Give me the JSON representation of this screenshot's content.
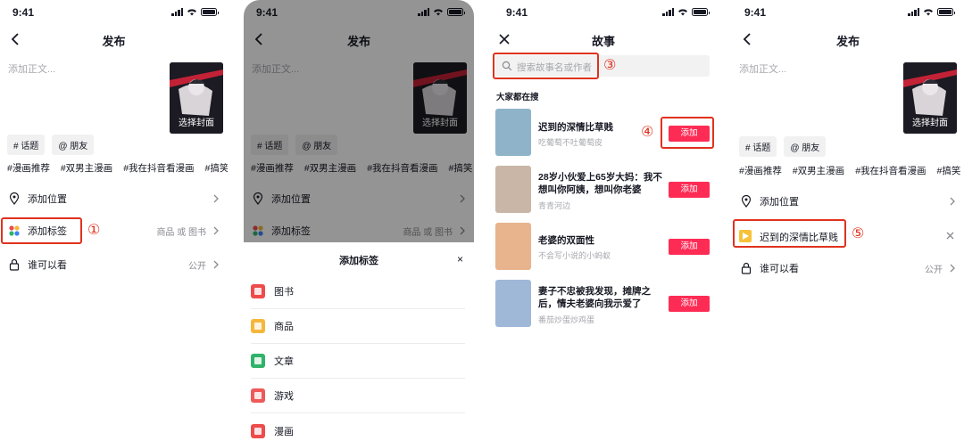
{
  "status": {
    "time": "9:41"
  },
  "screen1": {
    "title": "发布",
    "body_placeholder": "添加正文...",
    "cover_label": "选择封面",
    "chips": [
      "# 话题",
      "@ 朋友"
    ],
    "topics": [
      "#漫画推荐",
      "#双男主漫画",
      "#我在抖音看漫画",
      "#搞笑"
    ],
    "rows": {
      "location": "添加位置",
      "tag": "添加标签",
      "tag_value": "商品  或 图书",
      "visibility": "谁可以看",
      "visibility_value": "公开"
    },
    "marker": "①"
  },
  "screen2": {
    "title": "发布",
    "body_placeholder": "添加正文...",
    "cover_label": "选择封面",
    "chips": [
      "# 话题",
      "@ 朋友"
    ],
    "topics": [
      "#漫画推荐",
      "#双男主漫画",
      "#我在抖音看漫画",
      "#搞笑"
    ],
    "rows": {
      "location": "添加位置",
      "tag": "添加标签",
      "tag_value": "商品  或 图书"
    },
    "sheet": {
      "title": "添加标签",
      "close": "×",
      "items": [
        {
          "label": "图书",
          "color": "#ee4b4b"
        },
        {
          "label": "商品",
          "color": "#f5b73b"
        },
        {
          "label": "文章",
          "color": "#2fb36a"
        },
        {
          "label": "游戏",
          "color": "#ee5a5a"
        },
        {
          "label": "漫画",
          "color": "#ee4b4b"
        }
      ]
    }
  },
  "screen3": {
    "title": "故事",
    "search_placeholder": "搜索故事名或作者",
    "marker_search": "③",
    "marker_add": "④",
    "popular_label": "大家都在搜",
    "add_label": "添加",
    "stories": [
      {
        "title": "迟到的深情比草贱",
        "author": "吃葡萄不吐葡萄皮",
        "thumb": "#8fb3c9"
      },
      {
        "title": "28岁小伙爱上65岁大妈：我不想叫你阿姨，想叫你老婆",
        "author": "青青河边",
        "thumb": "#c9b6a6"
      },
      {
        "title": "老婆的双面性",
        "author": "不会写小说的小蚂蚁",
        "thumb": "#e7b48d"
      },
      {
        "title": "妻子不忠被我发现，摊牌之后，情夫老婆向我示爱了",
        "author": "番茄炒蛋炒鸡蛋",
        "thumb": "#9fb8d8"
      }
    ]
  },
  "screen4": {
    "title": "发布",
    "body_placeholder": "添加正文...",
    "cover_label": "选择封面",
    "chips": [
      "# 话题",
      "@ 朋友"
    ],
    "topics": [
      "#漫画推荐",
      "#双男主漫画",
      "#我在抖音看漫画",
      "#搞笑"
    ],
    "rows": {
      "location": "添加位置",
      "story_tag": "迟到的深情比草贱",
      "visibility": "谁可以看",
      "visibility_value": "公开"
    },
    "marker": "⑤"
  },
  "colors": {
    "accent": "#fe2c55",
    "annotation": "#e0321e"
  },
  "icons": [
    "back-icon",
    "close-icon",
    "location-pin-icon",
    "tag-icon",
    "lock-icon",
    "chevron-right-icon",
    "search-icon",
    "book-icon",
    "shop-icon",
    "article-icon",
    "game-icon",
    "comic-icon"
  ]
}
